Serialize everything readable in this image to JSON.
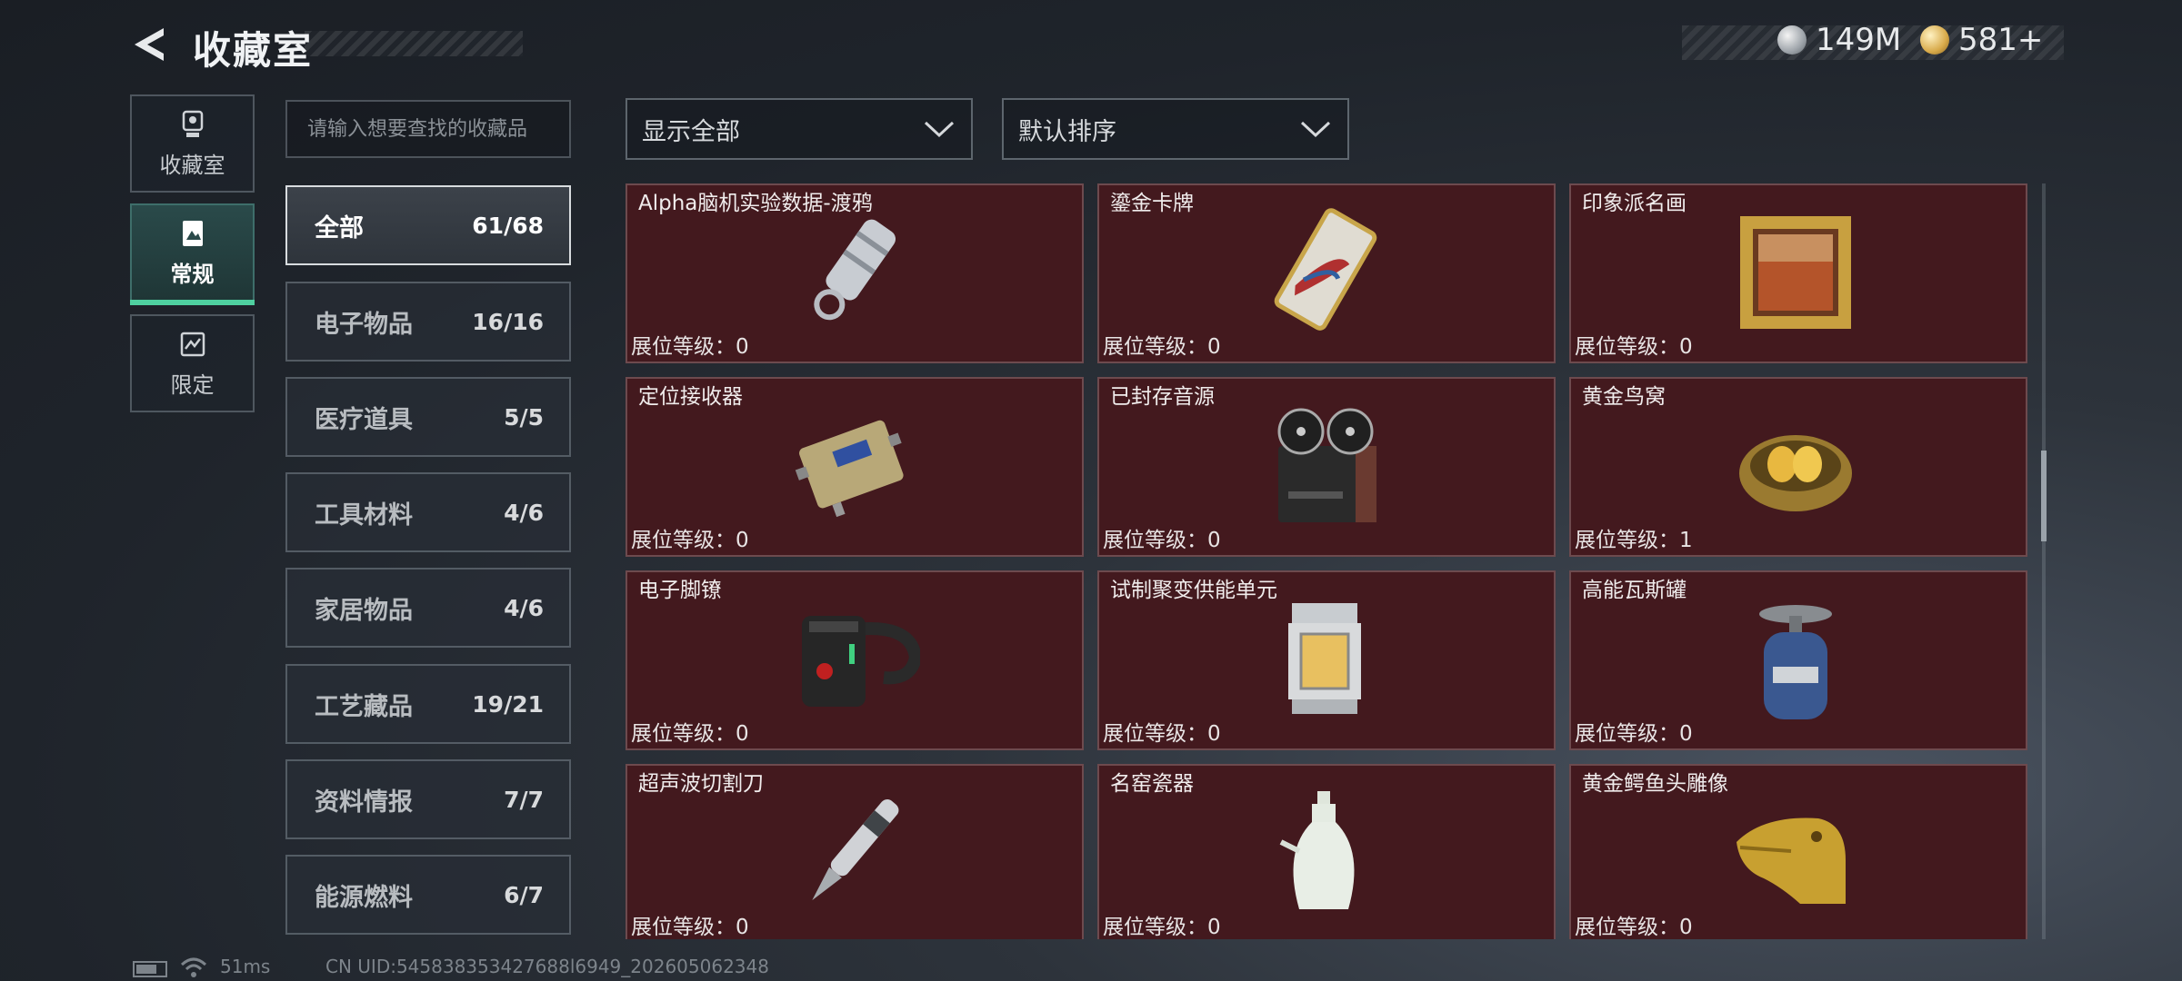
{
  "header": {
    "title": "收藏室",
    "currency": [
      {
        "icon": "silver-coin-icon",
        "value": "149M"
      },
      {
        "icon": "gold-coin-icon",
        "value": "581+"
      }
    ]
  },
  "side_tabs": [
    {
      "label": "收藏室",
      "icon": "trophy-icon",
      "active": false
    },
    {
      "label": "常规",
      "icon": "document-icon",
      "active": true
    },
    {
      "label": "限定",
      "icon": "limited-icon",
      "active": false
    }
  ],
  "search": {
    "placeholder": "请输入想要查找的收藏品",
    "value": ""
  },
  "categories": [
    {
      "name": "全部",
      "count": "61/68",
      "active": true
    },
    {
      "name": "电子物品",
      "count": "16/16"
    },
    {
      "name": "医疗道具",
      "count": "5/5"
    },
    {
      "name": "工具材料",
      "count": "4/6"
    },
    {
      "name": "家居物品",
      "count": "4/6"
    },
    {
      "name": "工艺藏品",
      "count": "19/21"
    },
    {
      "name": "资料情报",
      "count": "7/7"
    },
    {
      "name": "能源燃料",
      "count": "6/7"
    }
  ],
  "filters": {
    "display": "显示全部",
    "sort": "默认排序"
  },
  "items": [
    {
      "name": "Alpha脑机实验数据-渡鸦",
      "level": "展位等级：0",
      "icon": "usb-drive-keychain-icon"
    },
    {
      "name": "鎏金卡牌",
      "level": "展位等级：0",
      "icon": "gilded-card-icon"
    },
    {
      "name": "印象派名画",
      "level": "展位等级：0",
      "icon": "framed-painting-icon"
    },
    {
      "name": "定位接收器",
      "level": "展位等级：0",
      "icon": "locator-receiver-icon"
    },
    {
      "name": "已封存音源",
      "level": "展位等级：0",
      "icon": "reel-to-reel-recorder-icon"
    },
    {
      "name": "黄金鸟窝",
      "level": "展位等级：1",
      "icon": "golden-nest-icon"
    },
    {
      "name": "电子脚镣",
      "level": "展位等级：0",
      "icon": "ankle-monitor-icon"
    },
    {
      "name": "试制聚变供能单元",
      "level": "展位等级：0",
      "icon": "fusion-power-unit-icon"
    },
    {
      "name": "高能瓦斯罐",
      "level": "展位等级：0",
      "icon": "gas-canister-icon"
    },
    {
      "name": "超声波切割刀",
      "level": "展位等级：0",
      "icon": "ultrasonic-cutter-icon"
    },
    {
      "name": "名窑瓷器",
      "level": "展位等级：0",
      "icon": "porcelain-vase-icon"
    },
    {
      "name": "黄金鳄鱼头雕像",
      "level": "展位等级：0",
      "icon": "golden-crocodile-statue-icon"
    }
  ],
  "footer": {
    "ping": "51ms",
    "uid": "CN UID:545838353427688l6949_202605062348"
  },
  "colors": {
    "card_bg": "#43191e",
    "active_tab_accent": "#4fd0a0"
  }
}
